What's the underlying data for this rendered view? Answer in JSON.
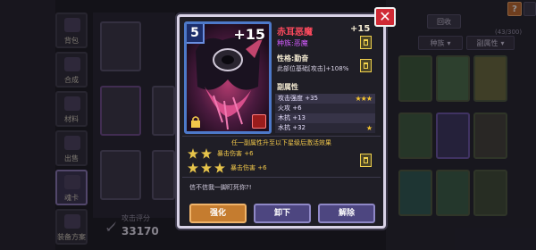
{
  "nav": [
    {
      "label": "背包",
      "active": false
    },
    {
      "label": "合成",
      "active": false
    },
    {
      "label": "材料",
      "active": false
    },
    {
      "label": "出售",
      "active": false
    },
    {
      "label": "魂卡",
      "active": true
    },
    {
      "label": "装备方案",
      "active": false
    }
  ],
  "power": {
    "label": "攻击评分",
    "value": "33170"
  },
  "topbar": {
    "recycle": "回收",
    "help": "?",
    "count": "(43/300)"
  },
  "filters": {
    "race": "种族",
    "secondary": "副属性"
  },
  "card": {
    "level": "5",
    "plus": "+15"
  },
  "modal": {
    "name": "赤耳恶魔",
    "plus": "+15",
    "race": "种族:恶魔",
    "trait_title": "性格:勤奋",
    "trait_desc": "此部位基础[攻击]+108%",
    "sub_title": "副属性",
    "stats": [
      {
        "text": "攻击强度 +35",
        "stars": "★★★"
      },
      {
        "text": "火攻 +6",
        "stars": ""
      },
      {
        "text": "木抗 +13",
        "stars": ""
      },
      {
        "text": "水抗 +32",
        "stars": "★"
      }
    ],
    "notice": "任一副属性升至以下星级后激活效果",
    "sets": [
      {
        "text": "暴击伤害 +6"
      },
      {
        "text": "暴击伤害 +6"
      }
    ],
    "flavor": "信不信我一脚盯死你?!",
    "buttons": {
      "upgrade": "强化",
      "unequip": "卸下",
      "dismantle": "解除"
    }
  },
  "colors": {
    "modal_border": "#d8d2e6",
    "name": "#ff4a5e",
    "race": "#d45cff",
    "gold": "#f2c84a",
    "close": "#d02a35"
  }
}
